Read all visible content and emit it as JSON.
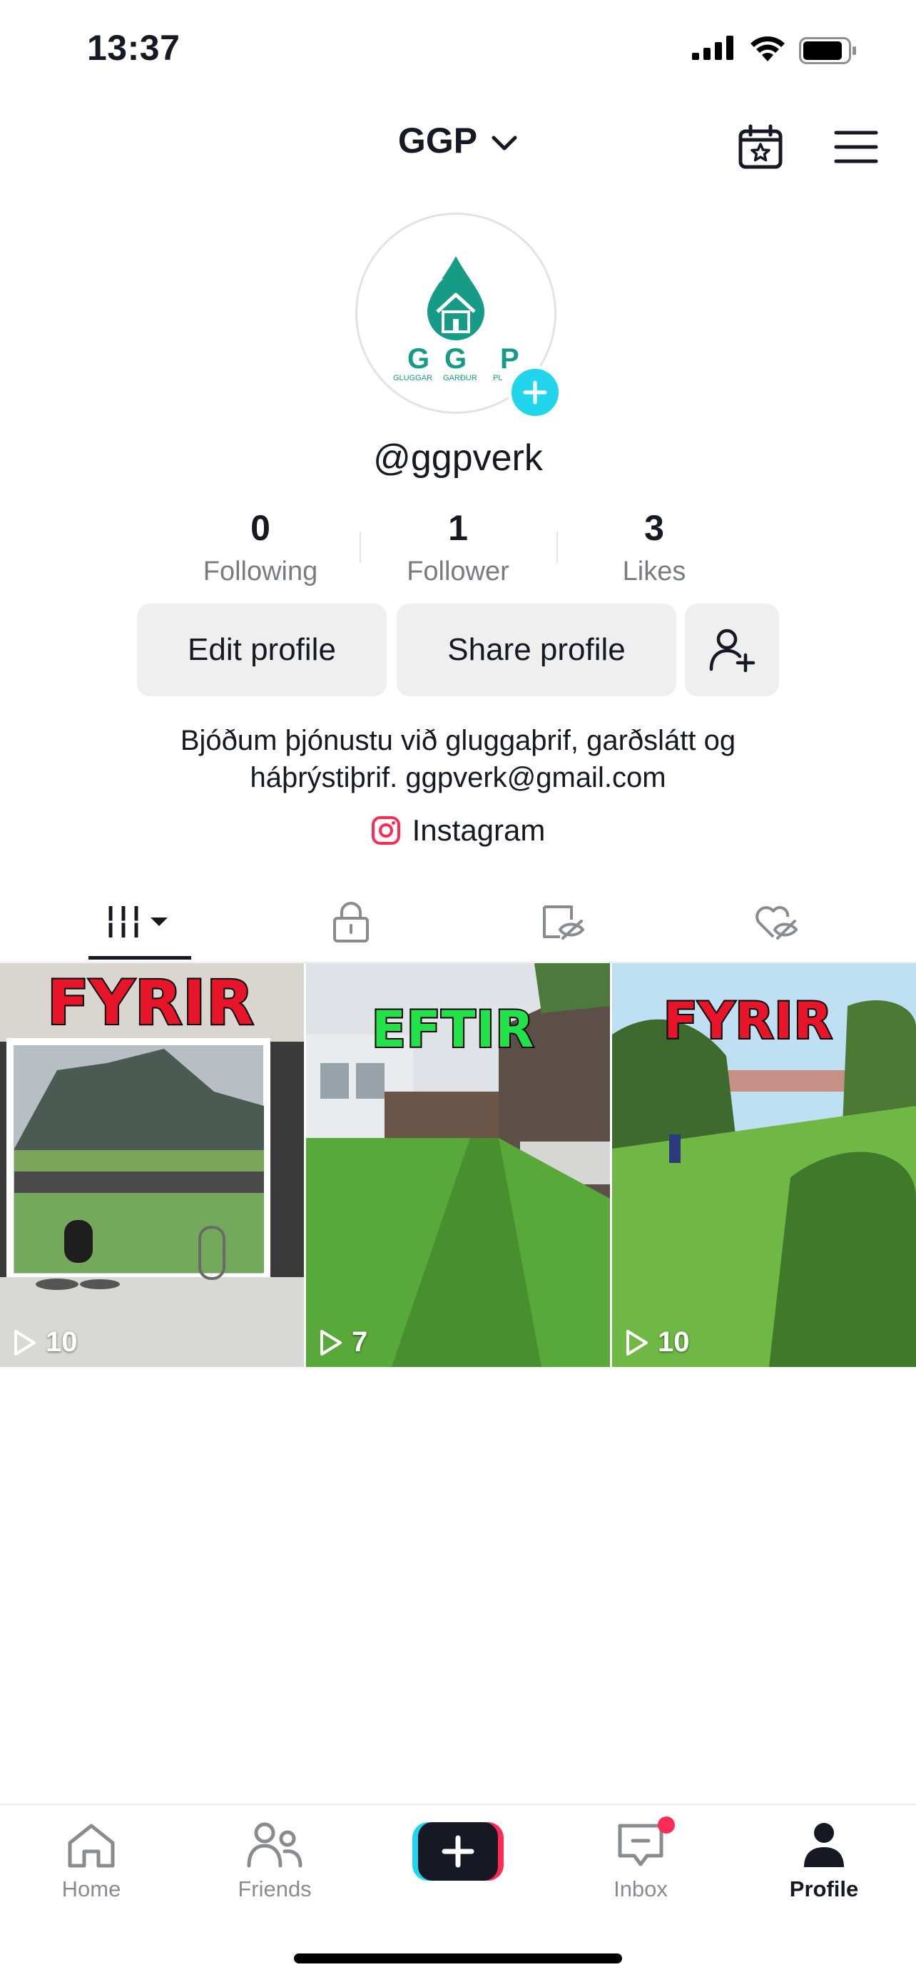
{
  "status_bar": {
    "time": "13:37",
    "icons": [
      "cellular-signal-icon",
      "wifi-icon",
      "battery-icon"
    ]
  },
  "header": {
    "account_name": "GGP",
    "icons": [
      "chevron-down-icon",
      "calendar-star-icon",
      "hamburger-menu-icon"
    ]
  },
  "profile": {
    "username": "@ggpverk",
    "avatar_logo": {
      "letters": [
        "G",
        "G",
        "P"
      ],
      "words": [
        "GLUGGAR",
        "GARÐUR",
        "PL"
      ]
    }
  },
  "stats": [
    {
      "value": "0",
      "label": "Following"
    },
    {
      "value": "1",
      "label": "Follower"
    },
    {
      "value": "3",
      "label": "Likes"
    }
  ],
  "actions": {
    "edit": "Edit profile",
    "share": "Share profile"
  },
  "bio": {
    "line1": "Bjóðum þjónustu við gluggaþrif, garðslátt og",
    "line2": "háþrýstiþrif. ggpverk@gmail.com"
  },
  "link": {
    "label": "Instagram"
  },
  "tabs": [
    "videos-grid-icon",
    "lock-icon",
    "hidden-reposts-icon",
    "liked-hidden-icon"
  ],
  "videos": [
    {
      "label": "FYRIR",
      "label_color": "#e8142a",
      "views": "10"
    },
    {
      "label": "EFTIR",
      "label_color": "#22e24a",
      "views": "7"
    },
    {
      "label": "FYRIR",
      "label_color": "#e8142a",
      "views": "10"
    }
  ],
  "nav": {
    "home": "Home",
    "friends": "Friends",
    "inbox": "Inbox",
    "profile": "Profile"
  },
  "colors": {
    "accent_cyan": "#20d5ec",
    "accent_pink": "#fe2c55",
    "brand_teal": "#159b86"
  }
}
